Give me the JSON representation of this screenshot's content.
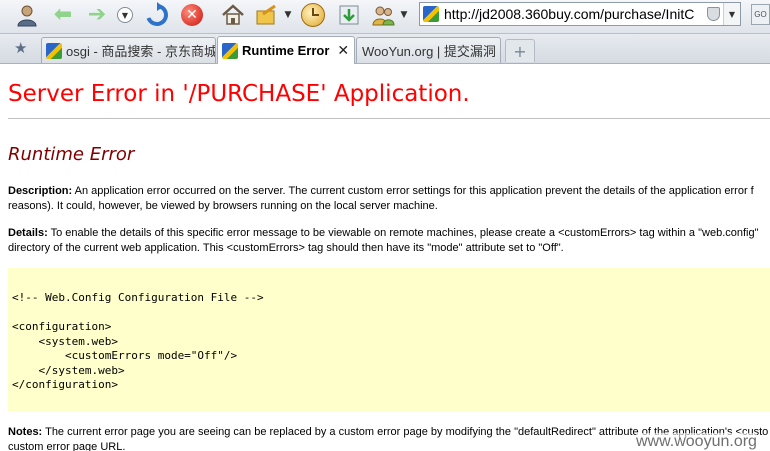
{
  "browser": {
    "toolbar_icons": {
      "user": "user-icon",
      "back": "back-arrow-icon",
      "forward": "forward-arrow-icon",
      "refresh": "refresh-icon",
      "stop": "stop-icon",
      "home": "home-icon",
      "favorites": "favorites-icon",
      "history": "history-clock-icon",
      "download": "download-icon",
      "contacts": "contacts-icon"
    },
    "address": "http://jd2008.360buy.com/purchase/InitC",
    "go_label": "GO",
    "tabs": [
      {
        "label": "osgi - 商品搜索 - 京东商城",
        "active": false
      },
      {
        "label": "Runtime Error",
        "active": true,
        "close": "✕"
      },
      {
        "label": "WooYun.org | 提交漏洞",
        "active": false
      }
    ],
    "new_tab_label": "+"
  },
  "page": {
    "title": "Server Error in '/PURCHASE' Application.",
    "subtitle": "Runtime Error",
    "description": {
      "label": "Description:",
      "line1": "An application error occurred on the server. The current custom error settings for this application prevent the details of the application error f",
      "line2": "reasons). It could, however, be viewed by browsers running on the local server machine."
    },
    "details": {
      "label": "Details:",
      "line1": "To enable the details of this specific error message to be viewable on remote machines, please create a <customErrors> tag within a \"web.config\"",
      "line2": "directory of the current web application. This <customErrors> tag should then have its \"mode\" attribute set to \"Off\"."
    },
    "code_lines": [
      "<!-- Web.Config Configuration File -->",
      "",
      "<configuration>",
      "    <system.web>",
      "        <customErrors mode=\"Off\"/>",
      "    </system.web>",
      "</configuration>"
    ],
    "notes": {
      "label": "Notes:",
      "line1": "The current error page you are seeing can be replaced by a custom error page by modifying the \"defaultRedirect\" attribute of the application's <custo",
      "line2": "custom error page URL."
    }
  },
  "watermark": "www.wooyun.org",
  "colors": {
    "title": "#ff0000",
    "subtitle": "#800000",
    "code_background": "#ffffcc"
  }
}
